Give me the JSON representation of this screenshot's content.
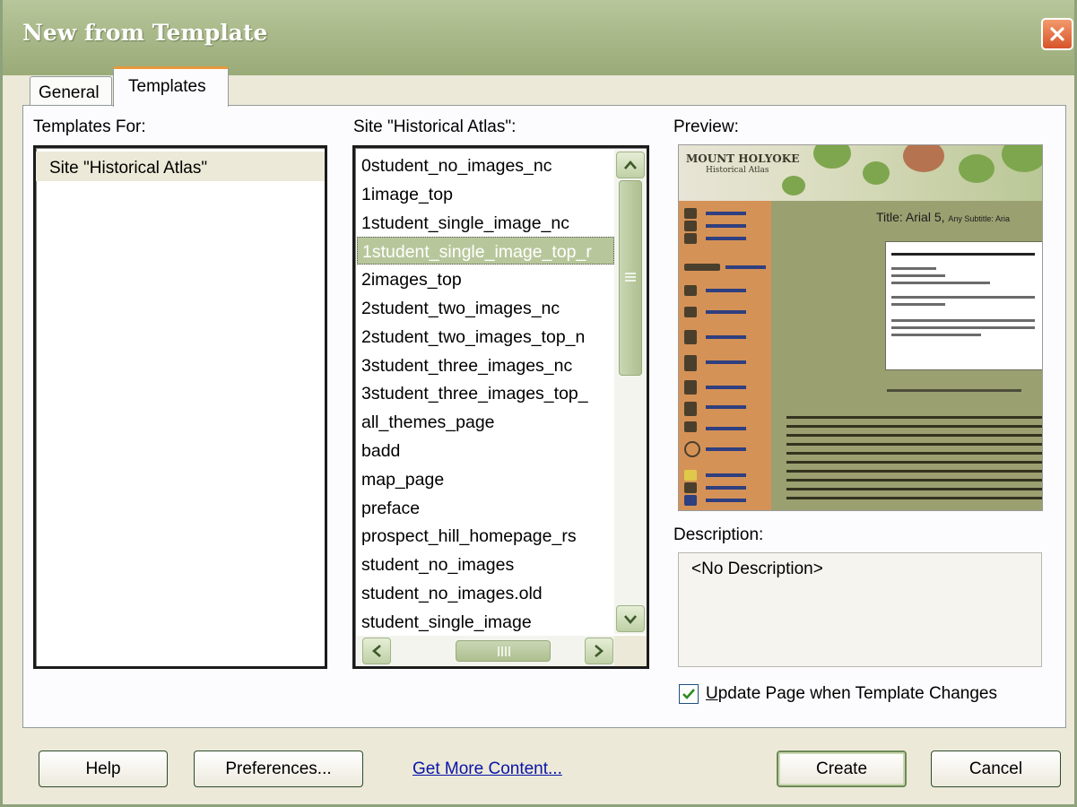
{
  "window": {
    "title": "New from Template"
  },
  "tabs": [
    {
      "label": "General",
      "active": false
    },
    {
      "label": "Templates",
      "active": true
    }
  ],
  "templates_for": {
    "label": "Templates For:",
    "items": [
      "Site \"Historical Atlas\""
    ],
    "selected_index": 0
  },
  "site_list": {
    "label": "Site \"Historical Atlas\":",
    "items": [
      "0student_no_images_nc",
      "1image_top",
      "1student_single_image_nc",
      "1student_single_image_top_r",
      "2images_top",
      "2student_two_images_nc",
      "2student_two_images_top_n",
      "3student_three_images_nc",
      "3student_three_images_top_",
      "all_themes_page",
      "badd",
      "map_page",
      "preface",
      "prospect_hill_homepage_rs",
      "student_no_images",
      "student_no_images.old",
      "student_single_image"
    ],
    "selected_index": 3
  },
  "preview": {
    "label": "Preview:",
    "logo": "MOUNT HOLYOKE",
    "logo_sub": "Historical Atlas",
    "title_text": "Title: Arial 5,",
    "title_sub": "Any Subtitle: Aria"
  },
  "description": {
    "label": "Description:",
    "value": "<No Description>"
  },
  "update_checkbox": {
    "accesskey": "U",
    "rest": "pdate Page when Template Changes",
    "checked": true
  },
  "buttons": {
    "help": "Help",
    "preferences": "Preferences...",
    "get_more": "Get More Content...",
    "create": "Create",
    "cancel": "Cancel"
  },
  "colors": {
    "titlebar": "#aab98a",
    "selection": "#b8c79b",
    "close": "#d8532a",
    "link": "#0a14a8",
    "tab_accent": "#e69a3c"
  }
}
